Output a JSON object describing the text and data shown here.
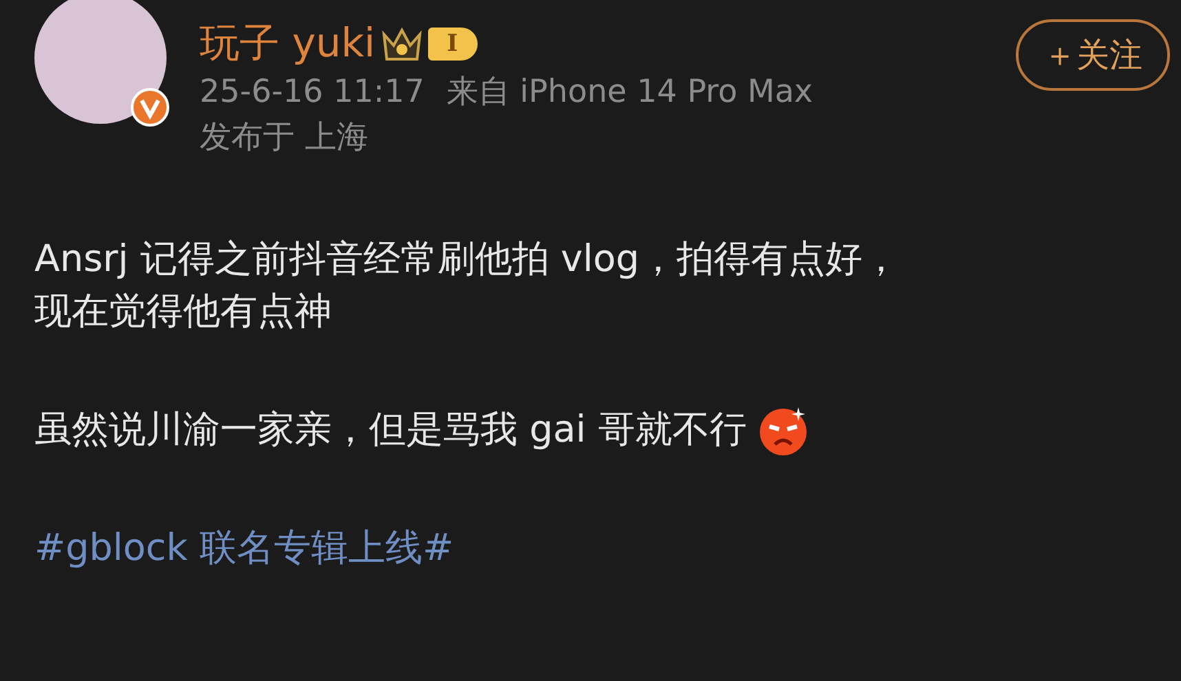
{
  "author": {
    "name": "玩子 yuki",
    "level_badge": "I",
    "verified": true,
    "time": "25-6-16 11:17",
    "source": "来自 iPhone 14 Pro Max",
    "location": "发布于 上海"
  },
  "follow_button": {
    "label": "＋关注"
  },
  "body": [
    {
      "kind": "text",
      "lines": [
        "Ansrj 记得之前抖音经常刷他拍 vlog，拍得有点好，",
        "现在觉得他有点神"
      ]
    },
    {
      "kind": "text_emoji",
      "lines": [
        "虽然说川渝一家亲，但是骂我 gai 哥就不行"
      ]
    },
    {
      "kind": "hashtag",
      "lines": [
        "#gblock 联名专辑上线#"
      ]
    }
  ]
}
